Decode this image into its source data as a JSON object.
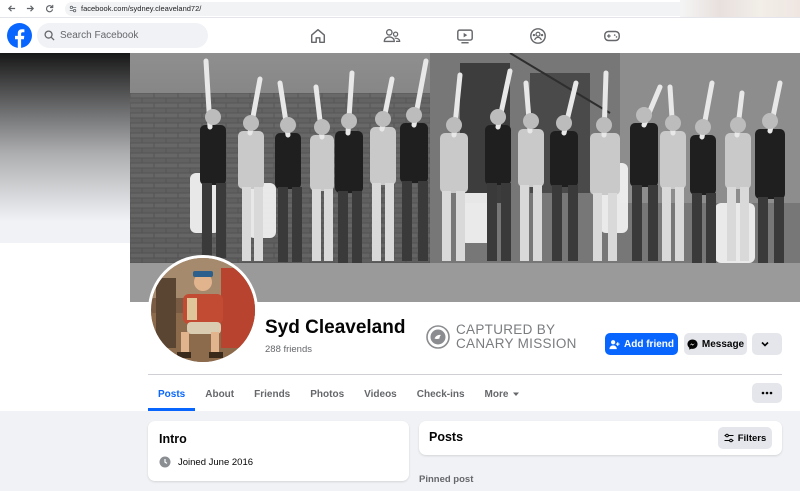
{
  "browser": {
    "url": "facebook.com/sydney.cleaveland72/"
  },
  "header": {
    "search_placeholder": "Search Facebook",
    "nav_items": [
      "home-icon",
      "friends-icon",
      "watch-icon",
      "groups-icon",
      "gaming-icon"
    ],
    "brand_color": "#0866ff"
  },
  "profile": {
    "name": "Syd Cleaveland",
    "friends": "288 friends",
    "watermark_line1": "CAPTURED BY",
    "watermark_line2": "CANARY MISSION",
    "add_friend_label": "Add friend",
    "message_label": "Message"
  },
  "tabs": [
    {
      "label": "Posts",
      "active": true
    },
    {
      "label": "About"
    },
    {
      "label": "Friends"
    },
    {
      "label": "Photos"
    },
    {
      "label": "Videos"
    },
    {
      "label": "Check-ins"
    },
    {
      "label": "More"
    }
  ],
  "intro": {
    "title": "Intro",
    "joined": "Joined June 2016"
  },
  "posts": {
    "title": "Posts",
    "filters_label": "Filters",
    "pinned_label": "Pinned post"
  }
}
